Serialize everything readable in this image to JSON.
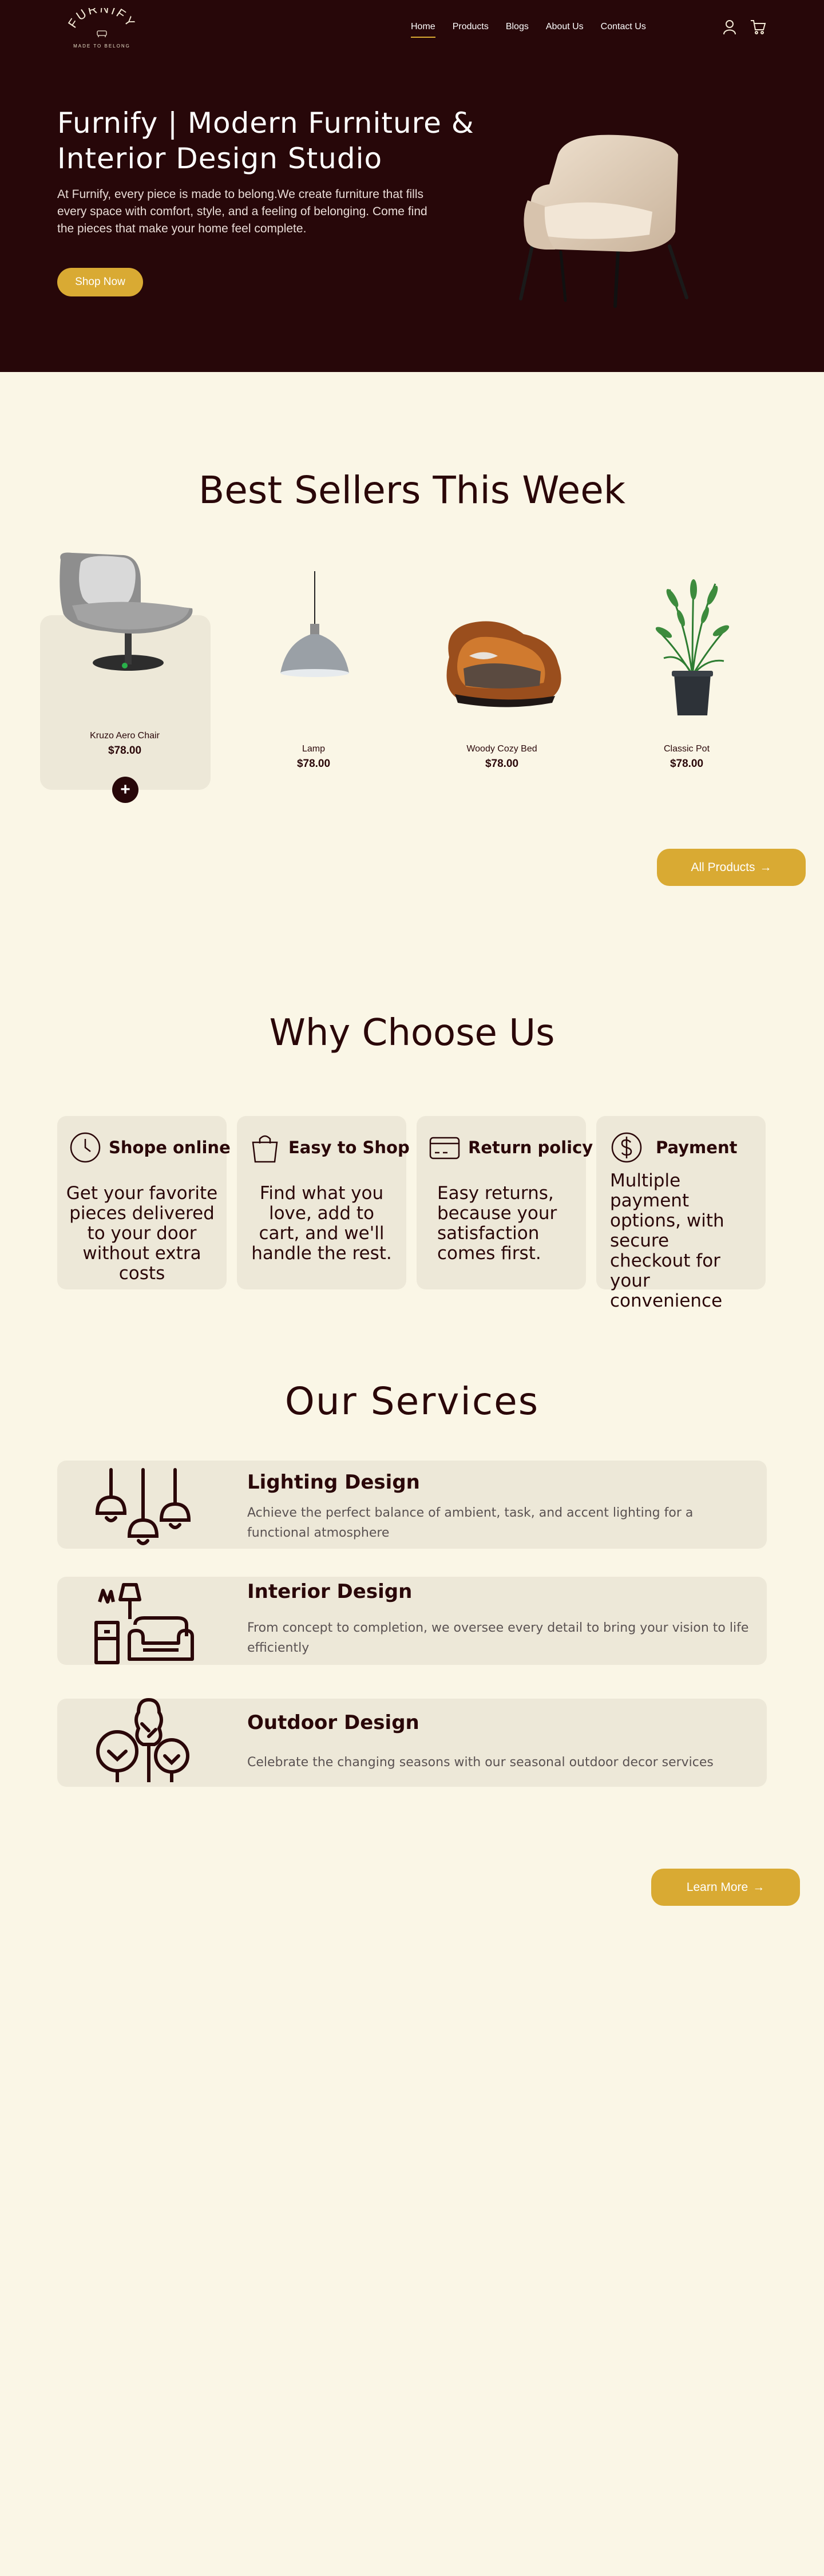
{
  "header": {
    "logo_text": "FURNIFY",
    "logo_tagline": "MADE TO BELONG",
    "nav": [
      {
        "label": "Home",
        "active": true
      },
      {
        "label": "Products",
        "active": false
      },
      {
        "label": "Blogs",
        "active": false
      },
      {
        "label": "About Us",
        "active": false
      },
      {
        "label": "Contact Us",
        "active": false
      }
    ],
    "icons": [
      "user-icon",
      "cart-icon"
    ]
  },
  "hero": {
    "title": "Furnify | Modern Furniture & Interior Design Studio",
    "text": "At Furnify, every piece is made to belong.We create furniture that fills every space with comfort, style, and a feeling of belonging. Come find the pieces that make your home feel complete.",
    "cta": "Shop Now"
  },
  "best_sellers": {
    "title": "Best Sellers This Week",
    "products": [
      {
        "name": "Kruzo Aero Chair",
        "price": "$78.00",
        "icon": "armchair-image"
      },
      {
        "name": "Lamp",
        "price": "$78.00",
        "icon": "pendant-lamp-image"
      },
      {
        "name": "Woody Cozy Bed",
        "price": "$78.00",
        "icon": "bed-image"
      },
      {
        "name": "Classic Pot",
        "price": "$78.00",
        "icon": "potted-plant-image"
      }
    ],
    "add_label": "+",
    "all_products": "All Products",
    "arrow": "→"
  },
  "why": {
    "title": "Why Choose Us",
    "cards": [
      {
        "title": "Shope online",
        "text": "Get your favorite pieces delivered to your door without extra costs",
        "icon": "clock-icon"
      },
      {
        "title": "Easy to Shop",
        "text": "Find what you love, add to cart, and we'll handle the rest.",
        "icon": "shopping-bag-icon"
      },
      {
        "title": "Return policy",
        "text": "Easy returns, because your satisfaction comes first.",
        "icon": "credit-card-icon"
      },
      {
        "title": "Payment",
        "text": "Multiple payment options, with secure checkout for your convenience",
        "icon": "dollar-icon"
      }
    ]
  },
  "services": {
    "title": "Our Services",
    "items": [
      {
        "name": "Lighting Design",
        "desc": "Achieve the perfect balance of ambient, task, and accent lighting for a functional atmosphere",
        "icon": "pendant-lights-icon"
      },
      {
        "name": "Interior Design",
        "desc": "From concept to completion, we oversee every detail to bring your vision to life efficiently",
        "icon": "armchair-lamp-icon"
      },
      {
        "name": "Outdoor Design",
        "desc": "Celebrate the changing seasons with our seasonal outdoor decor services",
        "icon": "trees-icon"
      }
    ],
    "learn_more": "Learn More",
    "arrow": "→"
  },
  "colors": {
    "hero_bg": "#270709",
    "page_bg": "#faf6e6",
    "card_bg": "#ede8d8",
    "accent": "#d9aa33",
    "text_dark": "#2a0709"
  }
}
